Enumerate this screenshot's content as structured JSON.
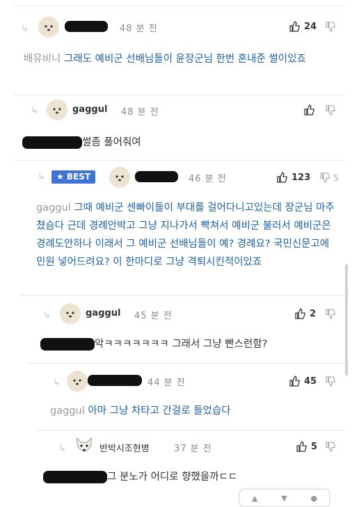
{
  "comments": [
    {
      "nick": "",
      "time": "48 분 전",
      "likes": "24",
      "dislikes": "",
      "mention": "배유비니",
      "text": "그래도 예비군 선배님들이 윤장군님 한번 혼내준 썰이있죠"
    },
    {
      "nick": "gaggul",
      "time": "48 분 전",
      "likes": "",
      "dislikes": "",
      "mention": "",
      "text": "썰좀 풀어줘여"
    },
    {
      "nick": "",
      "time": "46 분 전",
      "likes": "123",
      "dislikes": "5",
      "badge": "★ BEST",
      "mention": "gaggul",
      "text": "그때 예비군 센빠이들이 부대를 걸어다니고있는데 장군님 마주쳤슴다 근데 경례안박고 그냥 지나가서 빡쳐서 예비군 불러서 예비군은 경례도안하나 이래서 그 예비군 선배님들이 예? 경례요? 국민신문고에 민원 넣어드려요? 이 한마디로 그냥 격퇴시킨적이있죠"
    },
    {
      "nick": "gaggul",
      "time": "45 분 전",
      "likes": "2",
      "dislikes": "",
      "mention": "",
      "text": "악ㅋㅋㅋㅋㅋㅋㅋ 그래서 그냥 빤스런함?"
    },
    {
      "nick": "",
      "time": "44 분 전",
      "likes": "45",
      "dislikes": "",
      "mention": "gaggul",
      "text": "아마 그냥 차타고 간걸로 들었습다"
    },
    {
      "nick": "반박시조현병",
      "time": "37 분 전",
      "likes": "5",
      "dislikes": "",
      "mention": "",
      "text": "그 분노가 어디로 향했을까ㄷㄷ"
    }
  ],
  "icons": {
    "reply": "reply-arrow-icon",
    "like": "thumbs-up-icon",
    "dislike": "thumbs-down-icon",
    "avatar": "dog-avatar-icon"
  },
  "colors": {
    "best_badge": "#3f74d4",
    "comment_text_blue": "#1d5fa8",
    "mention_gray": "#999999"
  }
}
